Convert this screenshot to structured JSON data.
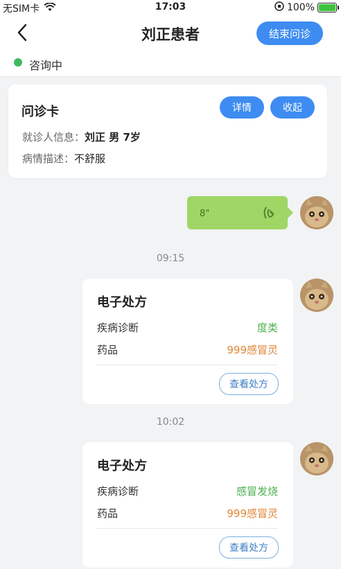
{
  "status_bar": {
    "carrier": "无SIM卡",
    "time": "17:03",
    "battery": "100%",
    "battery_level": 1.0
  },
  "header": {
    "title": "刘正患者",
    "end_button": "结束问诊"
  },
  "consult_status": {
    "text": "咨询中",
    "dot_color": "#3fb95f"
  },
  "consult_card": {
    "title": "问诊卡",
    "detail_button": "详情",
    "collapse_button": "收起",
    "patient_label": "就诊人信息：",
    "patient_value": "刘正 男 7岁",
    "desc_label": "病情描述：",
    "desc_value": "不舒服"
  },
  "voice_message": {
    "duration": "8\""
  },
  "messages": [
    {
      "time": "09:15",
      "title": "电子处方",
      "diagnosis_label": "疾病诊断",
      "diagnosis_value": "度类",
      "drug_label": "药品",
      "drug_value": "999感冒灵",
      "button": "查看处方"
    },
    {
      "time": "10:02",
      "title": "电子处方",
      "diagnosis_label": "疾病诊断",
      "diagnosis_value": "感冒发烧",
      "drug_label": "药品",
      "drug_value": "999感冒灵",
      "button": "查看处方"
    }
  ],
  "colors": {
    "accent": "#3e8cf2",
    "voice_bubble": "#9fd665",
    "diagnosis": "#4caf50",
    "drug": "#e0873a"
  }
}
